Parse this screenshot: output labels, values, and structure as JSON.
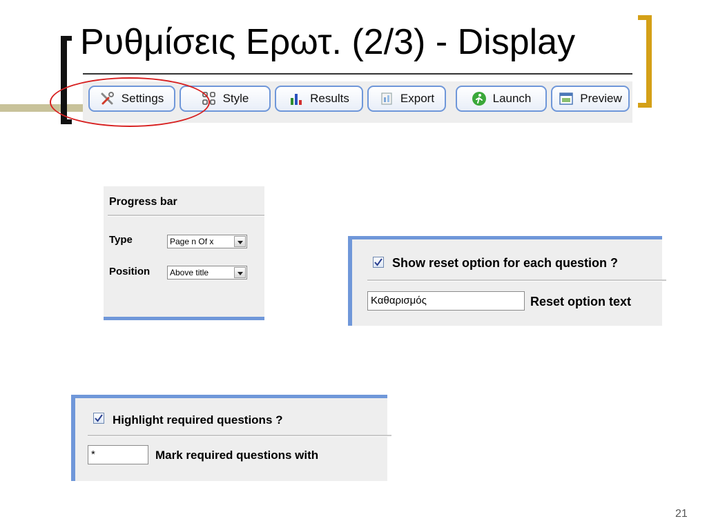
{
  "slide": {
    "title": "Ρυθμίσεις Ερωτ. (2/3) - Display",
    "page_number": "21"
  },
  "toolbar": {
    "buttons": [
      {
        "label": "Settings",
        "icon": "tools-icon"
      },
      {
        "label": "Style",
        "icon": "grid-icon"
      },
      {
        "label": "Results",
        "icon": "bar-chart-icon"
      },
      {
        "label": "Export",
        "icon": "export-icon"
      },
      {
        "label": "Launch",
        "icon": "launch-icon"
      },
      {
        "label": "Preview",
        "icon": "preview-icon"
      }
    ],
    "highlight_color": "#d72020"
  },
  "progress_panel": {
    "heading": "Progress bar",
    "type_label": "Type",
    "type_value": "Page n Of x",
    "position_label": "Position",
    "position_value": "Above title"
  },
  "reset_panel": {
    "checkbox_label": "Show reset option for each question ?",
    "checked": true,
    "text_value": "Καθαρισμός",
    "text_label": "Reset option text"
  },
  "required_panel": {
    "checkbox_label": "Highlight required questions ?",
    "checked": true,
    "mark_value": "*",
    "mark_label": "Mark required questions with"
  },
  "colors": {
    "panel_border": "#6f97d9",
    "accent_bracket": "#d4a017"
  }
}
